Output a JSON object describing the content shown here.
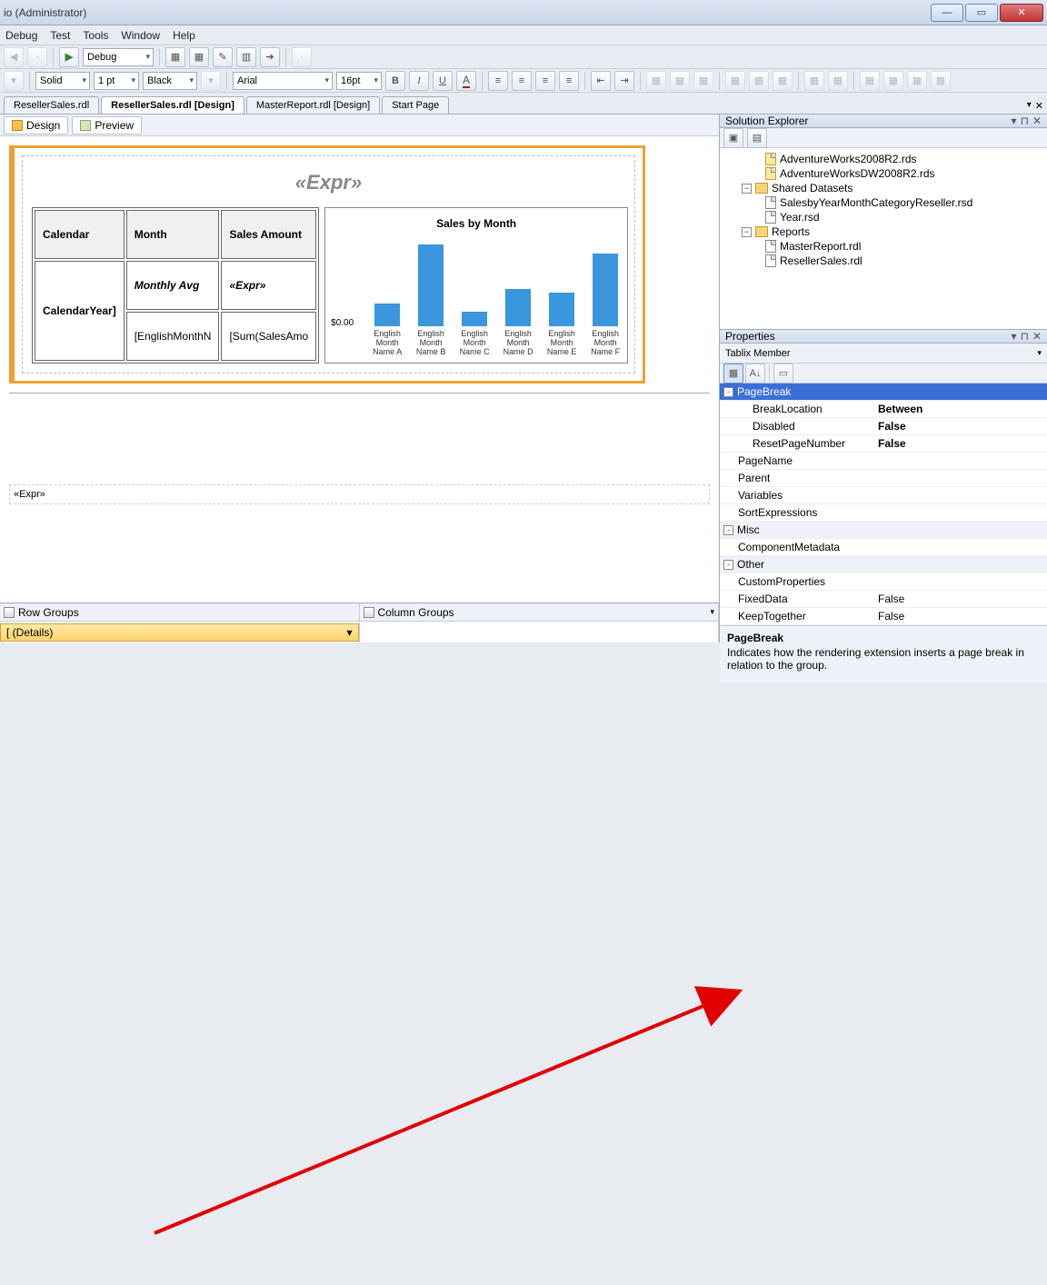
{
  "window": {
    "title": "io (Administrator)"
  },
  "menu": {
    "items": [
      "Debug",
      "Test",
      "Tools",
      "Window",
      "Help"
    ]
  },
  "toolbar1": {
    "play_label": "▶",
    "config": "Debug"
  },
  "toolbar2": {
    "line_style": "Solid",
    "line_width": "1 pt",
    "line_color": "Black",
    "font_family": "Arial",
    "font_size": "16pt",
    "bold": "B",
    "italic": "I",
    "underline": "U"
  },
  "doc_tabs": {
    "items": [
      {
        "label": "ResellerSales.rdl"
      },
      {
        "label": "ResellerSales.rdl [Design]"
      },
      {
        "label": "MasterReport.rdl [Design]"
      },
      {
        "label": "Start Page"
      }
    ],
    "active_index": 1
  },
  "view_tabs": {
    "design": "Design",
    "preview": "Preview"
  },
  "report": {
    "title_expr": "«Expr»",
    "tablix": {
      "headers": [
        "Calendar",
        "Month",
        "Sales Amount"
      ],
      "row1": [
        "",
        "Monthly Avg",
        "«Expr»"
      ],
      "row2_label": "CalendarYear]",
      "row2_cells": [
        "[EnglishMonthN",
        "[Sum(SalesAmo"
      ]
    },
    "footer_expr": "«Expr»"
  },
  "chart_data": {
    "type": "bar",
    "title": "Sales by Month",
    "ylabel": "$0.00",
    "categories": [
      "English Month Name A",
      "English Month Name B",
      "English Month Name C",
      "English Month Name D",
      "English Month Name E",
      "English Month Name F"
    ],
    "values": [
      22,
      78,
      14,
      36,
      32,
      70
    ]
  },
  "groups": {
    "row_label": "Row Groups",
    "col_label": "Column Groups",
    "details": "[ (Details)"
  },
  "solution_explorer": {
    "title": "Solution Explorer",
    "items": [
      {
        "type": "file",
        "label": "AdventureWorks2008R2.rds",
        "icon": "ds"
      },
      {
        "type": "file",
        "label": "AdventureWorksDW2008R2.rds",
        "icon": "ds"
      },
      {
        "type": "folder",
        "label": "Shared Datasets",
        "expanded": true
      },
      {
        "type": "file",
        "label": "SalesbyYearMonthCategoryReseller.rsd",
        "icon": "file",
        "indent": true
      },
      {
        "type": "file",
        "label": "Year.rsd",
        "icon": "file",
        "indent": true
      },
      {
        "type": "folder",
        "label": "Reports",
        "expanded": true
      },
      {
        "type": "file",
        "label": "MasterReport.rdl",
        "icon": "file",
        "indent": true
      },
      {
        "type": "file",
        "label": "ResellerSales.rdl",
        "icon": "file",
        "indent": true
      }
    ]
  },
  "properties": {
    "title": "Properties",
    "object": "Tablix Member",
    "rows": [
      {
        "cat": true,
        "exp": "-",
        "name": "PageBreak",
        "selected": true
      },
      {
        "name": "BreakLocation",
        "val": "Between",
        "bold": true,
        "indent": true
      },
      {
        "name": "Disabled",
        "val": "False",
        "bold": true,
        "indent": true
      },
      {
        "name": "ResetPageNumber",
        "val": "False",
        "bold": true,
        "indent": true
      },
      {
        "name": "PageName",
        "val": ""
      },
      {
        "name": "Parent",
        "val": ""
      },
      {
        "name": "Variables",
        "val": ""
      },
      {
        "name": "SortExpressions",
        "val": "",
        "noindent": true
      },
      {
        "cat": true,
        "exp": "-",
        "name": "Misc"
      },
      {
        "name": "ComponentMetadata",
        "val": ""
      },
      {
        "cat": true,
        "exp": "-",
        "name": "Other"
      },
      {
        "name": "CustomProperties",
        "val": ""
      },
      {
        "name": "FixedData",
        "val": "False"
      },
      {
        "name": "KeepTogether",
        "val": "False"
      }
    ],
    "desc_title": "PageBreak",
    "desc_body": "Indicates how the rendering extension inserts a page break in relation to the group."
  }
}
